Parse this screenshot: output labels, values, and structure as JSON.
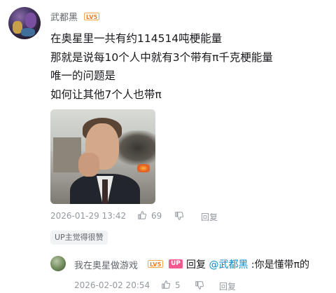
{
  "comment": {
    "username": "武都黑",
    "level_badge": "LV5",
    "lines": [
      "在奥星里一共有约114514吨梗能量",
      "那就是说每10个人中就有3个带有π千克梗能量",
      "唯一的问题是",
      "如何让其他7个人也带π"
    ],
    "time": "2026-01-29 13:42",
    "like_count": "69",
    "reply_label": "回复",
    "up_liked": "UP主觉得很赞"
  },
  "reply": {
    "username": "我在奥星做游戏",
    "level_badge": "LV5",
    "up_badge": "UP",
    "reply_word": "回复",
    "mention": "@武都黑",
    "text": " :你是懂带π的",
    "time": "2026-02-02 20:54",
    "like_count": "5",
    "reply_label": "回复"
  },
  "colors": {
    "mention": "#008ac5",
    "up_badge": "#f45a8d",
    "level_badge": "#f07b1d",
    "meta": "#9499a0"
  },
  "icons": [
    "thumb-up-icon",
    "thumb-down-icon"
  ]
}
